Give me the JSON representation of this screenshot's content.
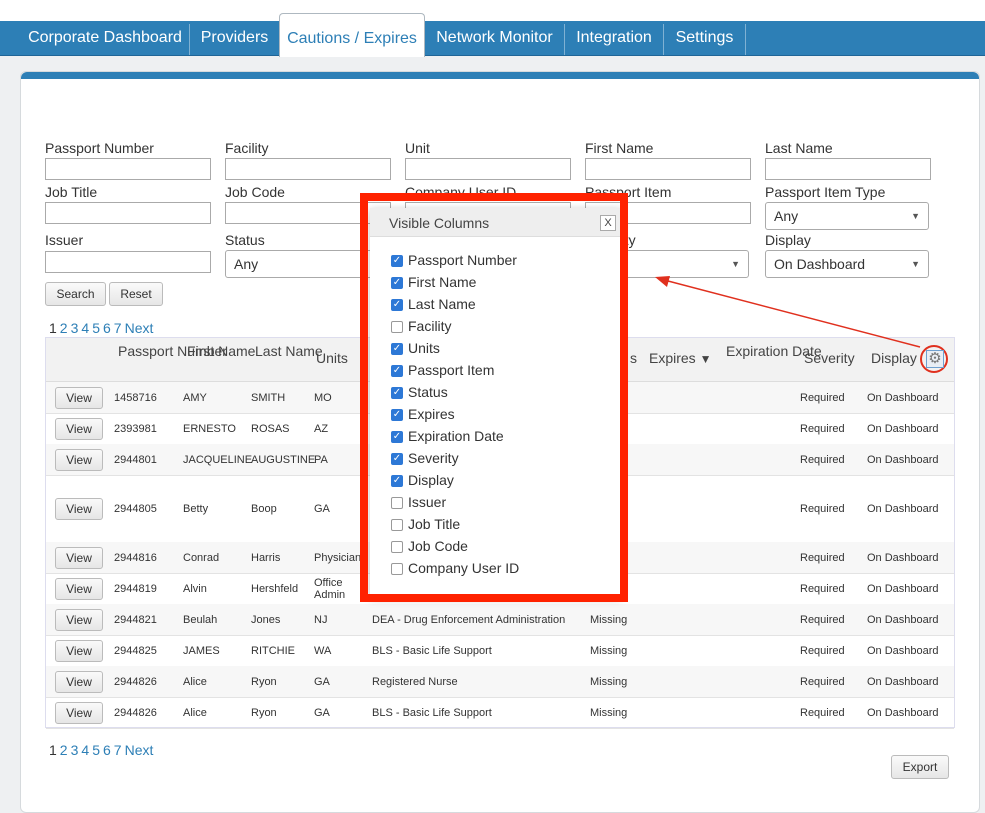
{
  "nav": {
    "tabs": [
      {
        "label": "Corporate Dashboard"
      },
      {
        "label": "Providers"
      },
      {
        "label": "Cautions / Expires"
      },
      {
        "label": "Network Monitor"
      },
      {
        "label": "Integration"
      },
      {
        "label": "Settings"
      }
    ],
    "active": "Cautions / Expires"
  },
  "filters": {
    "passport_number": "Passport Number",
    "facility": "Facility",
    "unit": "Unit",
    "first_name": "First Name",
    "last_name": "Last Name",
    "job_title": "Job Title",
    "job_code": "Job Code",
    "company_user_id": "Company User ID",
    "passport_item": "Passport Item",
    "passport_item_type": "Passport Item Type",
    "passport_item_type_value": "Any",
    "issuer": "Issuer",
    "status": "Status",
    "status_value": "Any",
    "severity": "Severity",
    "display": "Display",
    "display_value": "On Dashboard"
  },
  "buttons": {
    "search": "Search",
    "reset": "Reset",
    "view": "View",
    "export": "Export"
  },
  "pager": {
    "pages": [
      "1",
      "2",
      "3",
      "4",
      "5",
      "6",
      "7"
    ],
    "next": "Next"
  },
  "table": {
    "headers": {
      "passport_number": "Passport Number",
      "first_name": "First Name",
      "last_name": "Last Name",
      "units": "Units",
      "status_suffix": "s",
      "expires": "Expires",
      "expiration_date": "Expiration Date",
      "severity": "Severity",
      "display": "Display"
    },
    "rows": [
      {
        "id": "1458716",
        "first": "AMY",
        "last": "SMITH",
        "unit": "MO",
        "item": "",
        "status": "",
        "severity": "Required",
        "display": "On Dashboard"
      },
      {
        "id": "2393981",
        "first": "ERNESTO",
        "last": "ROSAS",
        "unit": "AZ",
        "item": "",
        "status": "",
        "severity": "Required",
        "display": "On Dashboard"
      },
      {
        "id": "2944801",
        "first": "JACQUELINE",
        "last": "AUGUSTINE",
        "unit": "PA",
        "item": "",
        "status": "",
        "severity": "Required",
        "display": "On Dashboard"
      },
      {
        "id": "2944805",
        "first": "Betty",
        "last": "Boop",
        "unit": "GA",
        "item": "",
        "status": "",
        "severity": "Required",
        "display": "On Dashboard"
      },
      {
        "id": "2944816",
        "first": "Conrad",
        "last": "Harris",
        "unit": "Physician",
        "item": "",
        "status": "",
        "severity": "Required",
        "display": "On Dashboard"
      },
      {
        "id": "2944819",
        "first": "Alvin",
        "last": "Hershfeld",
        "unit": "Office Admin",
        "item": "",
        "status": "",
        "severity": "Required",
        "display": "On Dashboard"
      },
      {
        "id": "2944821",
        "first": "Beulah",
        "last": "Jones",
        "unit": "NJ",
        "item": "DEA - Drug Enforcement Administration",
        "status": "Missing",
        "severity": "Required",
        "display": "On Dashboard"
      },
      {
        "id": "2944825",
        "first": "JAMES",
        "last": "RITCHIE",
        "unit": "WA",
        "item": "BLS - Basic Life Support",
        "status": "Missing",
        "severity": "Required",
        "display": "On Dashboard"
      },
      {
        "id": "2944826",
        "first": "Alice",
        "last": "Ryon",
        "unit": "GA",
        "item": "Registered Nurse",
        "status": "Missing",
        "severity": "Required",
        "display": "On Dashboard"
      },
      {
        "id": "2944826",
        "first": "Alice",
        "last": "Ryon",
        "unit": "GA",
        "item": "BLS - Basic Life Support",
        "status": "Missing",
        "severity": "Required",
        "display": "On Dashboard"
      }
    ]
  },
  "popup": {
    "title": "Visible Columns",
    "close": "X",
    "columns": [
      {
        "label": "Passport Number",
        "checked": true
      },
      {
        "label": "First Name",
        "checked": true
      },
      {
        "label": "Last Name",
        "checked": true
      },
      {
        "label": "Facility",
        "checked": false
      },
      {
        "label": "Units",
        "checked": true
      },
      {
        "label": "Passport Item",
        "checked": true
      },
      {
        "label": "Status",
        "checked": true
      },
      {
        "label": "Expires",
        "checked": true
      },
      {
        "label": "Expiration Date",
        "checked": true
      },
      {
        "label": "Severity",
        "checked": true
      },
      {
        "label": "Display",
        "checked": true
      },
      {
        "label": "Issuer",
        "checked": false
      },
      {
        "label": "Job Title",
        "checked": false
      },
      {
        "label": "Job Code",
        "checked": false
      },
      {
        "label": "Company User ID",
        "checked": false
      }
    ]
  },
  "icons": {
    "settings": "gear-icon",
    "sort": "sort-desc-icon",
    "dropdown": "chevron-down-icon",
    "checkbox": "checkmark-icon"
  },
  "colors": {
    "brand": "#2d7fb6",
    "annotation": "#ff2200",
    "checkbox": "#2d78d6"
  }
}
